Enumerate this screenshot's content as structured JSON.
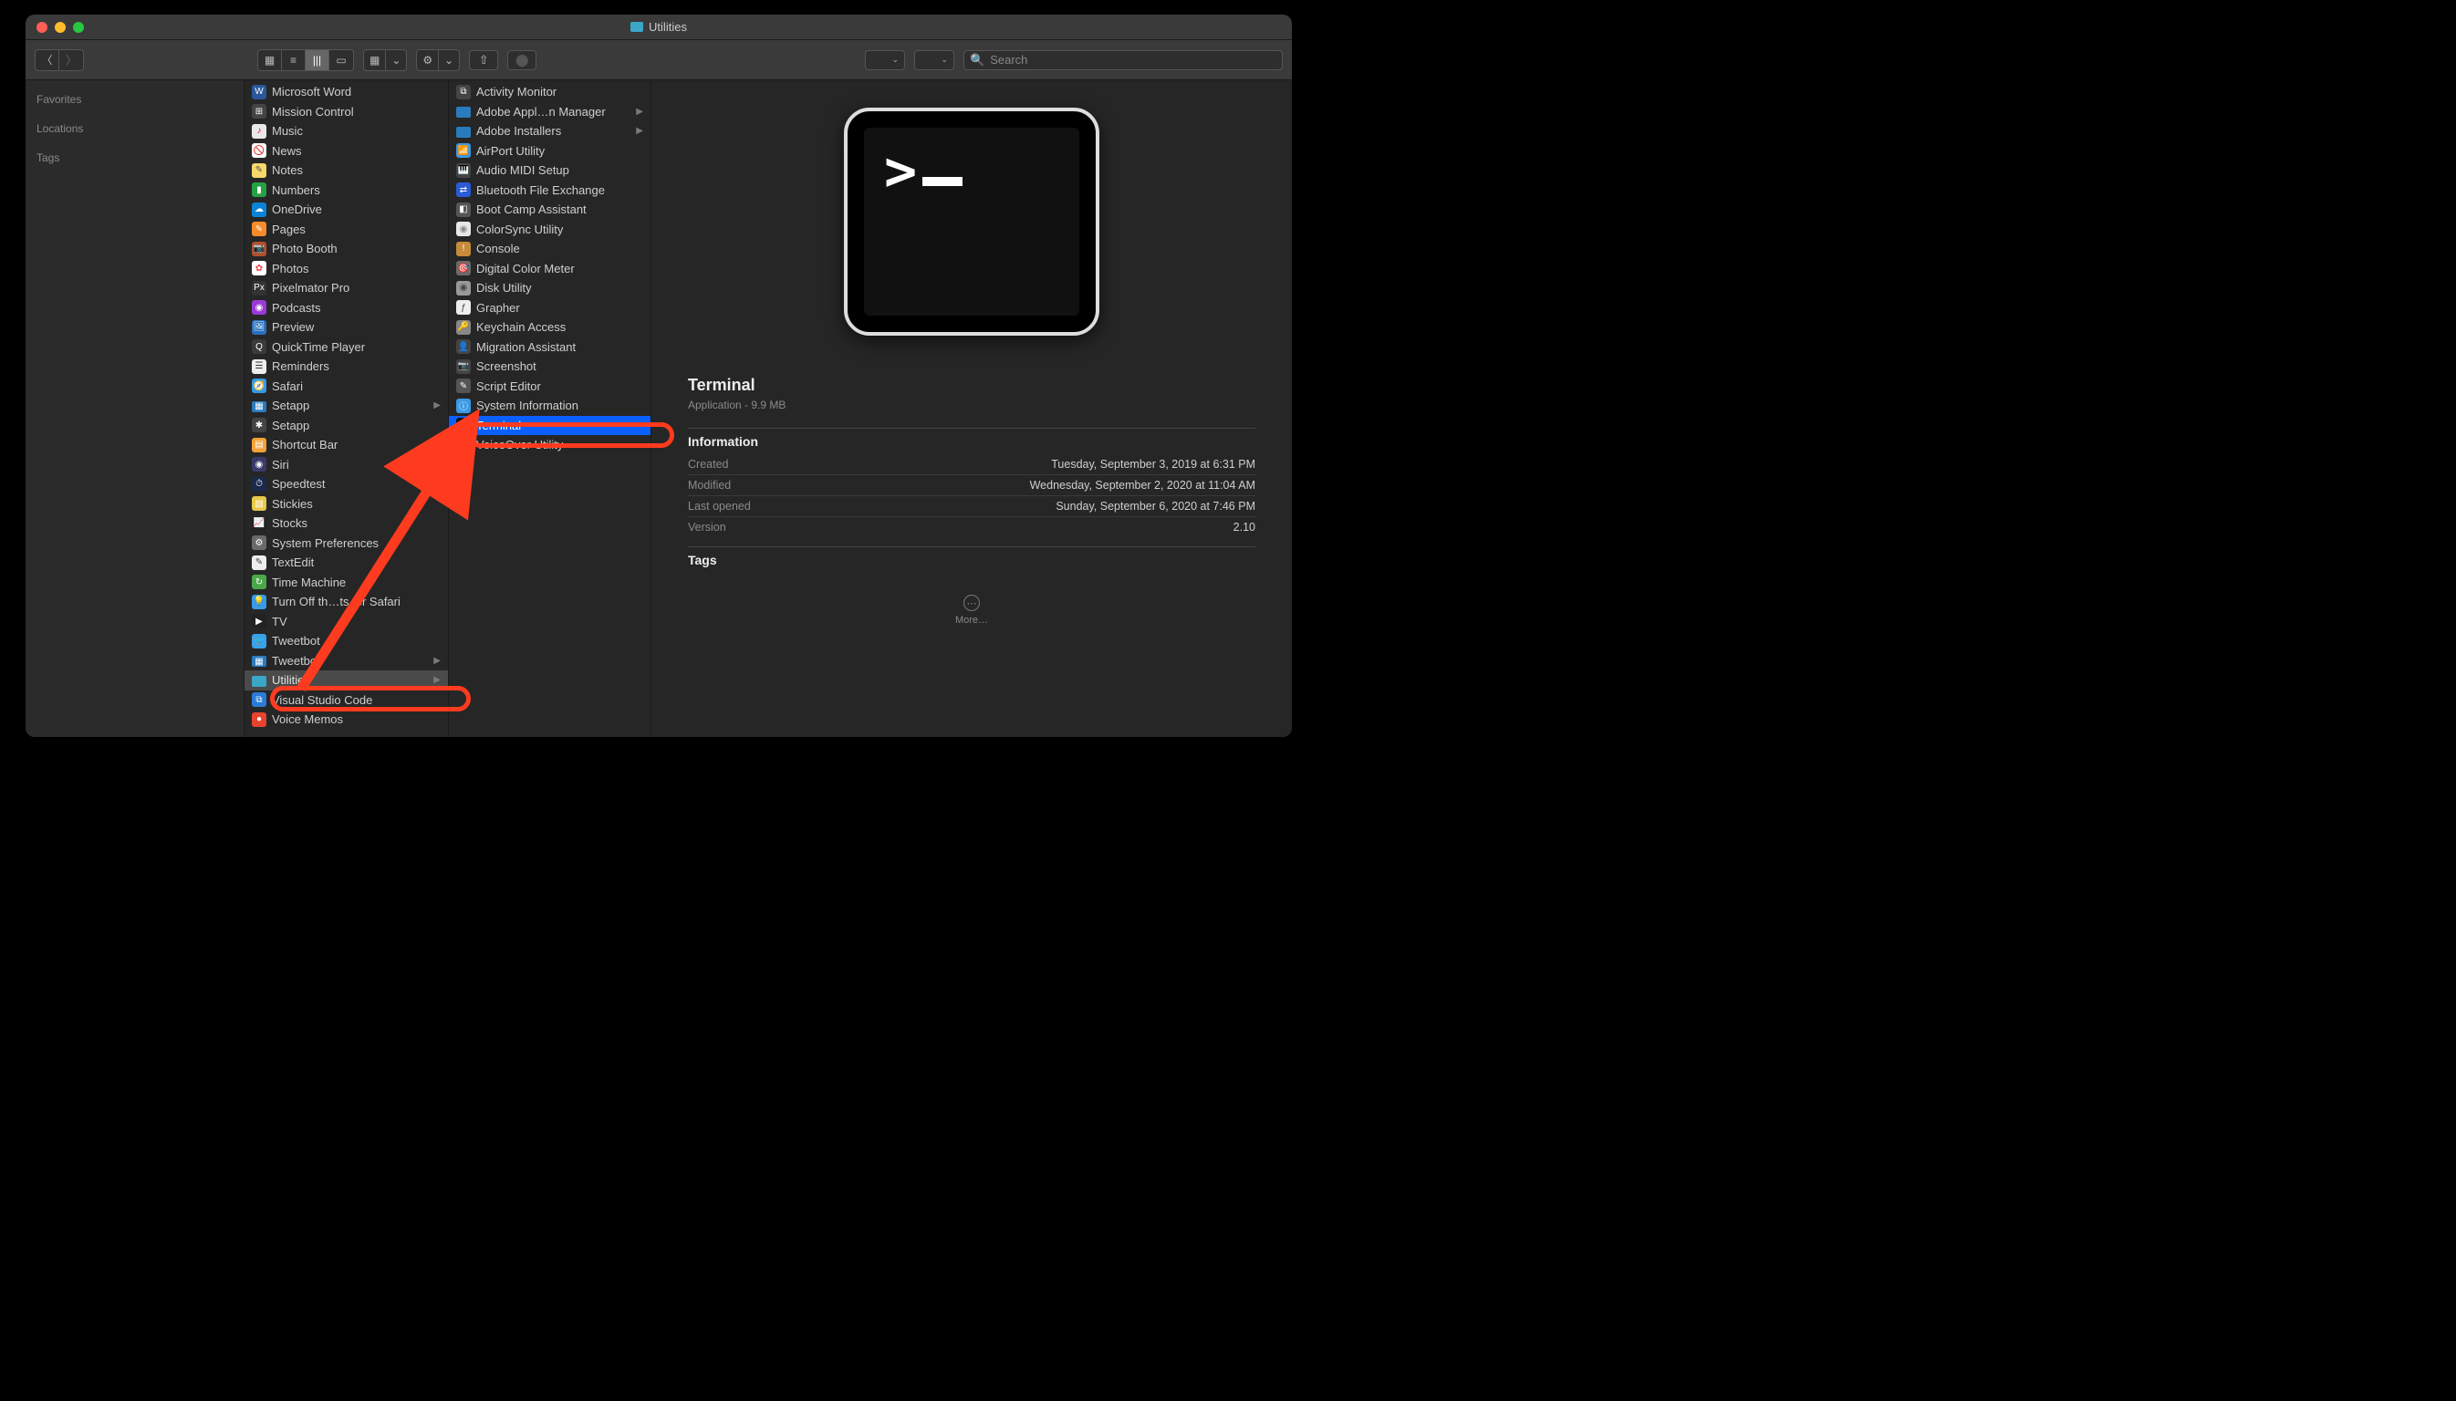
{
  "window_title": "Utilities",
  "search_placeholder": "Search",
  "sidebar": {
    "favorites": "Favorites",
    "locations": "Locations",
    "tags": "Tags"
  },
  "apps": [
    {
      "label": "Microsoft Word",
      "bg": "#2b579a",
      "g": "W"
    },
    {
      "label": "Mission Control",
      "bg": "#444",
      "g": "⊞"
    },
    {
      "label": "Music",
      "bg": "#e8e8e8",
      "g": "♪",
      "fg": "#e03"
    },
    {
      "label": "News",
      "bg": "#fff",
      "g": "🚫",
      "fg": "#c00"
    },
    {
      "label": "Notes",
      "bg": "#f7d86a",
      "g": "✎",
      "fg": "#555"
    },
    {
      "label": "Numbers",
      "bg": "#25a244",
      "g": "▮"
    },
    {
      "label": "OneDrive",
      "bg": "#0a84d6",
      "g": "☁"
    },
    {
      "label": "Pages",
      "bg": "#f78b2b",
      "g": "✎"
    },
    {
      "label": "Photo Booth",
      "bg": "#b14f2e",
      "g": "📷"
    },
    {
      "label": "Photos",
      "bg": "#fff",
      "g": "✿",
      "fg": "#e44"
    },
    {
      "label": "Pixelmator Pro",
      "bg": "#333",
      "g": "Px"
    },
    {
      "label": "Podcasts",
      "bg": "#9a3ad6",
      "g": "◉"
    },
    {
      "label": "Preview",
      "bg": "#2a6fbd",
      "g": "🖼"
    },
    {
      "label": "QuickTime Player",
      "bg": "#3a3a3a",
      "g": "Q"
    },
    {
      "label": "Reminders",
      "bg": "#eee",
      "g": "☰",
      "fg": "#333"
    },
    {
      "label": "Safari",
      "bg": "#349be8",
      "g": "🧭"
    },
    {
      "label": "Setapp",
      "bg": "#2a7bbd",
      "g": "▦",
      "hasChildren": true,
      "isFolder": true
    },
    {
      "label": "Setapp",
      "bg": "#444",
      "g": "✱"
    },
    {
      "label": "Shortcut Bar",
      "bg": "#f2a33a",
      "g": "▤"
    },
    {
      "label": "Siri",
      "bg": "#3a3a6a",
      "g": "◉"
    },
    {
      "label": "Speedtest",
      "bg": "#1a2a4a",
      "g": "⏱"
    },
    {
      "label": "Stickies",
      "bg": "#e8c94a",
      "g": "▧"
    },
    {
      "label": "Stocks",
      "bg": "#222",
      "g": "📈"
    },
    {
      "label": "System Preferences",
      "bg": "#6a6a6a",
      "g": "⚙"
    },
    {
      "label": "TextEdit",
      "bg": "#eee",
      "g": "✎",
      "fg": "#444"
    },
    {
      "label": "Time Machine",
      "bg": "#4aa84a",
      "g": "↻"
    },
    {
      "label": "Turn Off th…ts for Safari",
      "bg": "#3a9ae6",
      "g": "💡"
    },
    {
      "label": "TV",
      "bg": "#222",
      "g": "▶"
    },
    {
      "label": "Tweetbot",
      "bg": "#3aa0ea",
      "g": "🐦"
    },
    {
      "label": "Tweetbot",
      "bg": "#2a7bbd",
      "g": "▦",
      "hasChildren": true,
      "isFolder": true
    },
    {
      "label": "Utilities",
      "bg": "#3aa7c7",
      "g": "",
      "hasChildren": true,
      "selected": "dim",
      "isFolder": true,
      "annot": true
    },
    {
      "label": "Visual Studio Code",
      "bg": "#2a7bd6",
      "g": "⧉"
    },
    {
      "label": "Voice Memos",
      "bg": "#e8432e",
      "g": "●"
    }
  ],
  "utilities": [
    {
      "label": "Activity Monitor",
      "bg": "#444",
      "g": "⧉"
    },
    {
      "label": "Adobe Appl…n Manager",
      "bg": "#2a7bbd",
      "g": "",
      "hasChildren": true,
      "isFolder": true
    },
    {
      "label": "Adobe Installers",
      "bg": "#2a7bbd",
      "g": "",
      "hasChildren": true,
      "isFolder": true
    },
    {
      "label": "AirPort Utility",
      "bg": "#3a9ae6",
      "g": "📶"
    },
    {
      "label": "Audio MIDI Setup",
      "bg": "#444",
      "g": "🎹"
    },
    {
      "label": "Bluetooth File Exchange",
      "bg": "#2a5bd6",
      "g": "⇄"
    },
    {
      "label": "Boot Camp Assistant",
      "bg": "#555",
      "g": "◧"
    },
    {
      "label": "ColorSync Utility",
      "bg": "#e8e8e8",
      "g": "◉",
      "fg": "#888"
    },
    {
      "label": "Console",
      "bg": "#c78a3a",
      "g": "!"
    },
    {
      "label": "Digital Color Meter",
      "bg": "#6a6a6a",
      "g": "🎯"
    },
    {
      "label": "Disk Utility",
      "bg": "#999",
      "g": "◉",
      "fg": "#444"
    },
    {
      "label": "Grapher",
      "bg": "#eee",
      "g": "ƒ",
      "fg": "#444"
    },
    {
      "label": "Keychain Access",
      "bg": "#888",
      "g": "🔑"
    },
    {
      "label": "Migration Assistant",
      "bg": "#444",
      "g": "👤"
    },
    {
      "label": "Screenshot",
      "bg": "#444",
      "g": "📷"
    },
    {
      "label": "Script Editor",
      "bg": "#555",
      "g": "✎"
    },
    {
      "label": "System Information",
      "bg": "#3a9ae6",
      "g": "ⓘ"
    },
    {
      "label": "Terminal",
      "bg": "#111",
      "g": ">",
      "selected": true,
      "annot": true
    },
    {
      "label": "VoiceOver Utility",
      "bg": "#888",
      "g": "👤"
    }
  ],
  "preview": {
    "name": "Terminal",
    "subtitle": "Application - 9.9 MB",
    "info_head": "Information",
    "rows": [
      {
        "k": "Created",
        "v": "Tuesday, September 3, 2019 at 6:31 PM"
      },
      {
        "k": "Modified",
        "v": "Wednesday, September 2, 2020 at 11:04 AM"
      },
      {
        "k": "Last opened",
        "v": "Sunday, September 6, 2020 at 7:46 PM"
      },
      {
        "k": "Version",
        "v": "2.10"
      }
    ],
    "tags_head": "Tags",
    "more": "More…",
    "prompt": ">_"
  },
  "colors": {
    "close": "#ff5f57",
    "min": "#ffbd2e",
    "max": "#28c840",
    "annot": "#ff3b1f",
    "select": "#0a60ff"
  }
}
